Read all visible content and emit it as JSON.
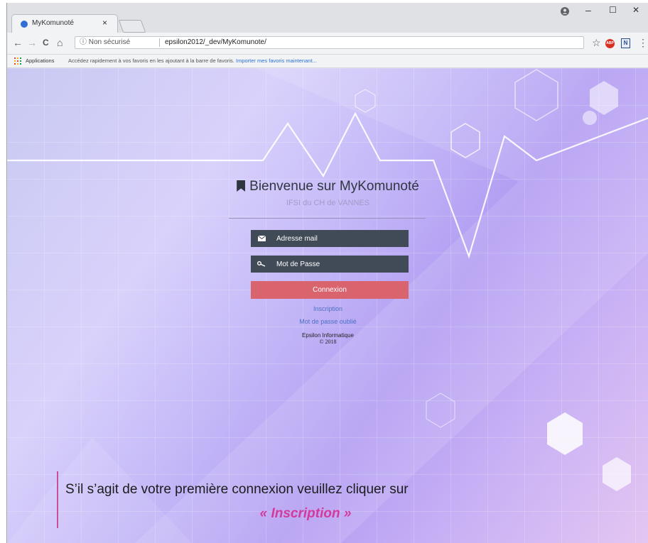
{
  "browser": {
    "tab_title": "MyKomunoté",
    "tab_close": "×",
    "window_controls": {
      "minimize": "–",
      "maximize": "☐",
      "close": "✕"
    },
    "account_icon": "account-circle-icon",
    "nav": {
      "back": "←",
      "forward": "→",
      "reload": "C",
      "home": "⌂"
    },
    "address": {
      "security_label": "ⓘ Non sécurisé",
      "url": "epsilon2012/_dev/MyKomunote/"
    },
    "toolbar": {
      "star": "☆",
      "abp": "ABP",
      "ext_n": "N",
      "menu": "⋮"
    },
    "bookmarks": {
      "apps_label": "Applications",
      "hint": "Accédez rapidement à vos favoris en les ajoutant à la barre de favoris.",
      "import_link": "Importer mes favoris maintenant..."
    }
  },
  "login": {
    "title": "Bienvenue sur MyKomunoté",
    "subtitle": "IFSI du CH de VANNES",
    "email": {
      "placeholder": "Adresse mail",
      "icon": "envelope-icon"
    },
    "password": {
      "placeholder": "Mot de Passe",
      "icon": "key-icon"
    },
    "submit_label": "Connexion",
    "register_link": "Inscription",
    "forgot_link": "Mot de passe oublié",
    "footer_org": "Epsilon Informatique",
    "footer_copy": "© 2018"
  },
  "callout": {
    "text": "S’il s’agit de votre première connexion veuillez cliquer sur",
    "emphasis": "« Inscription »"
  },
  "colors": {
    "field_bg": "#414a57",
    "button_bg": "#d9646e",
    "link": "#4b71c4",
    "accent": "#d4399c"
  }
}
